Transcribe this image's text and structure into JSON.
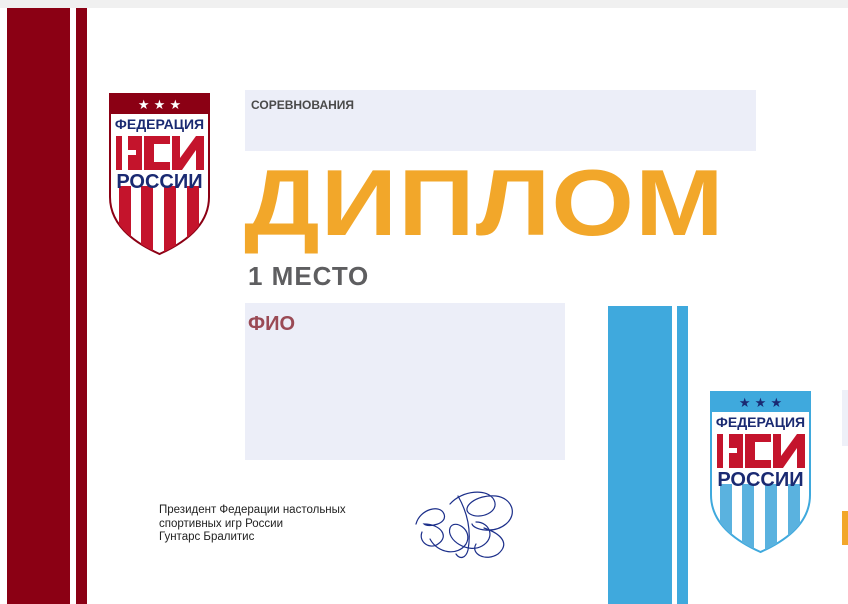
{
  "colors": {
    "maroon": "#8b0014",
    "orange": "#f2a72a",
    "gray_title": "#5e5e60",
    "light_blue": "#3fa9dd",
    "field_bg": "#eceef8",
    "crest_red": "#c4142c",
    "crest_navy": "#1a2a72",
    "crest_light_blue": "#5ab2df"
  },
  "diploma": {
    "competition_label": "СОРЕВНОВАНИЯ",
    "title": "ДИПЛОМ",
    "place": "1 МЕСТО",
    "name_label": "ФИО"
  },
  "crest": {
    "stars": "★ ★ ★",
    "line1": "ФЕДЕРАЦИЯ",
    "line3": "РОССИИ",
    "alt": "НСИ"
  },
  "signature": {
    "lines": [
      "Президент Федерации настольных",
      "спортивных игр России",
      "Гунтарс Бралитис"
    ]
  }
}
